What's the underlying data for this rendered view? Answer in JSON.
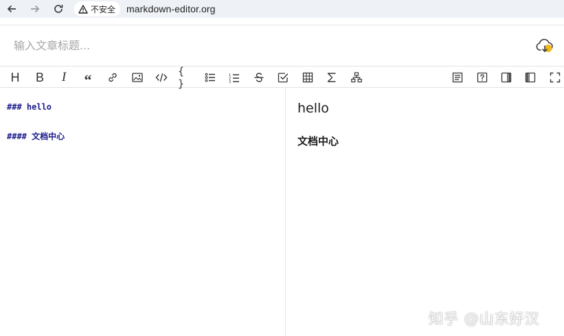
{
  "browser": {
    "security_label": "不安全",
    "url": "markdown-editor.org"
  },
  "editor": {
    "title_placeholder": "输入文章标题...",
    "title_value": "",
    "source_lines": [
      "### hello",
      "#### 文档中心"
    ]
  },
  "preview": {
    "h3": "hello",
    "h4": "文档中心"
  },
  "toolbar": {
    "heading_glyph": "H",
    "bold_glyph": "B",
    "italic_glyph": "I",
    "quote_glyph": "“",
    "braces_glyph": "{ }"
  },
  "watermark": "知乎 @山东好汉",
  "colors": {
    "accent_cloud": "#f2b81e",
    "markdown_text": "#1a1a8c"
  }
}
